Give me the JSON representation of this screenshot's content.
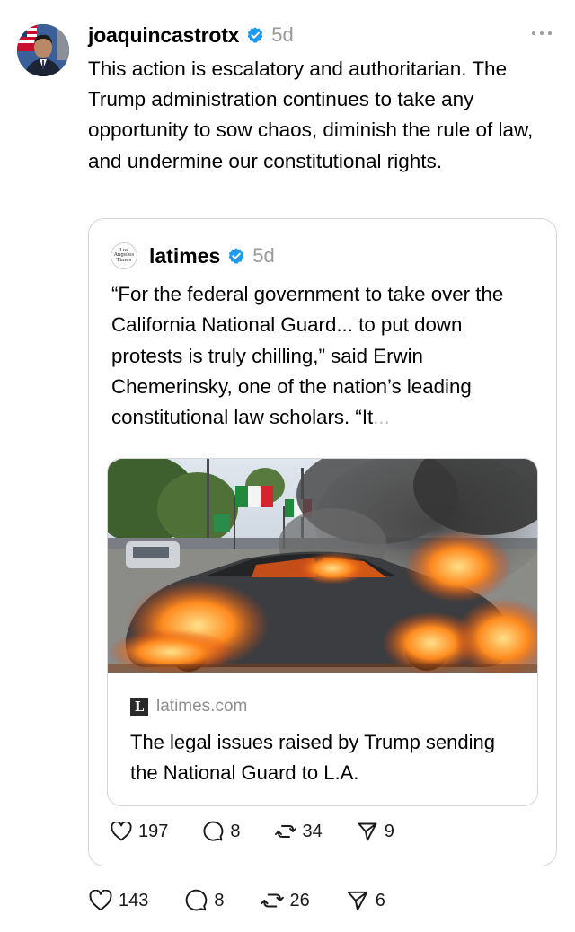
{
  "post": {
    "username": "joaquincastrotx",
    "time": "5d",
    "text": "This action is escalatory and authoritarian. The Trump administration continues to take any opportunity to sow chaos, diminish the rule of law, and undermine our constitutional rights.",
    "icons": {
      "avatar": "avatar-photo",
      "verified": "verified-badge-icon",
      "more": "more-options-icon"
    },
    "actions": {
      "likes": "143",
      "replies": "8",
      "reposts": "26",
      "shares": "6"
    }
  },
  "quoted": {
    "username": "latimes",
    "time": "5d",
    "avatar_text": [
      "Los",
      "Angeles",
      "Times"
    ],
    "text_main": "“For the federal government to take over the California National Guard... to put down protests is truly chilling,” said Erwin Chemerinsky, one of the nation’s leading constitutional law scholars. “It",
    "text_faded": "...",
    "link": {
      "favicon_letter": "L",
      "domain": "latimes.com",
      "title": "The legal issues raised by Trump sending the National Guard to L.A."
    },
    "actions": {
      "likes": "197",
      "replies": "8",
      "reposts": "34",
      "shares": "9"
    }
  },
  "colors": {
    "verified": "#1d9bf0",
    "muted": "#9a9a9a",
    "border": "#d6d6d6"
  }
}
